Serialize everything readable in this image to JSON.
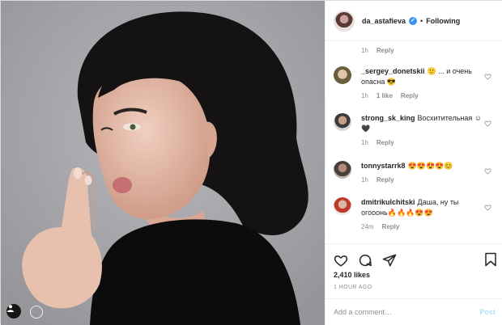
{
  "post": {
    "username": "da_astafieva",
    "verified_glyph": "✓",
    "separator": "•",
    "follow_status": "Following"
  },
  "top_meta": {
    "time": "1h",
    "reply": "Reply"
  },
  "comments": [
    {
      "username": "_sergey_donetskii",
      "text": "🙂 ... и очень опасна 😎",
      "time": "1h",
      "likes": "1 like",
      "reply": "Reply"
    },
    {
      "username": "strong_sk_king",
      "text": "Восхитительная ☺🖤",
      "time": "1h",
      "reply": "Reply"
    },
    {
      "username": "tonnystarrk8",
      "text": "😍😍😍😍😊",
      "time": "1h",
      "reply": "Reply"
    },
    {
      "username": "dmitrikulchitski",
      "text": "Даша, ну ты огооонь🔥🔥🔥😍😍",
      "time": "24m",
      "reply": "Reply"
    }
  ],
  "actions": {
    "like_icon": "heart-icon",
    "comment_icon": "comment-icon",
    "share_icon": "share-icon",
    "save_icon": "bookmark-icon"
  },
  "likes": "2,410 likes",
  "timestamp": "1 HOUR AGO",
  "comment_box": {
    "placeholder": "Add a comment…",
    "post_label": "Post"
  },
  "colors": {
    "accent": "#3897f0",
    "post_disabled": "#b2dffc",
    "muted": "#8e8e8e"
  }
}
